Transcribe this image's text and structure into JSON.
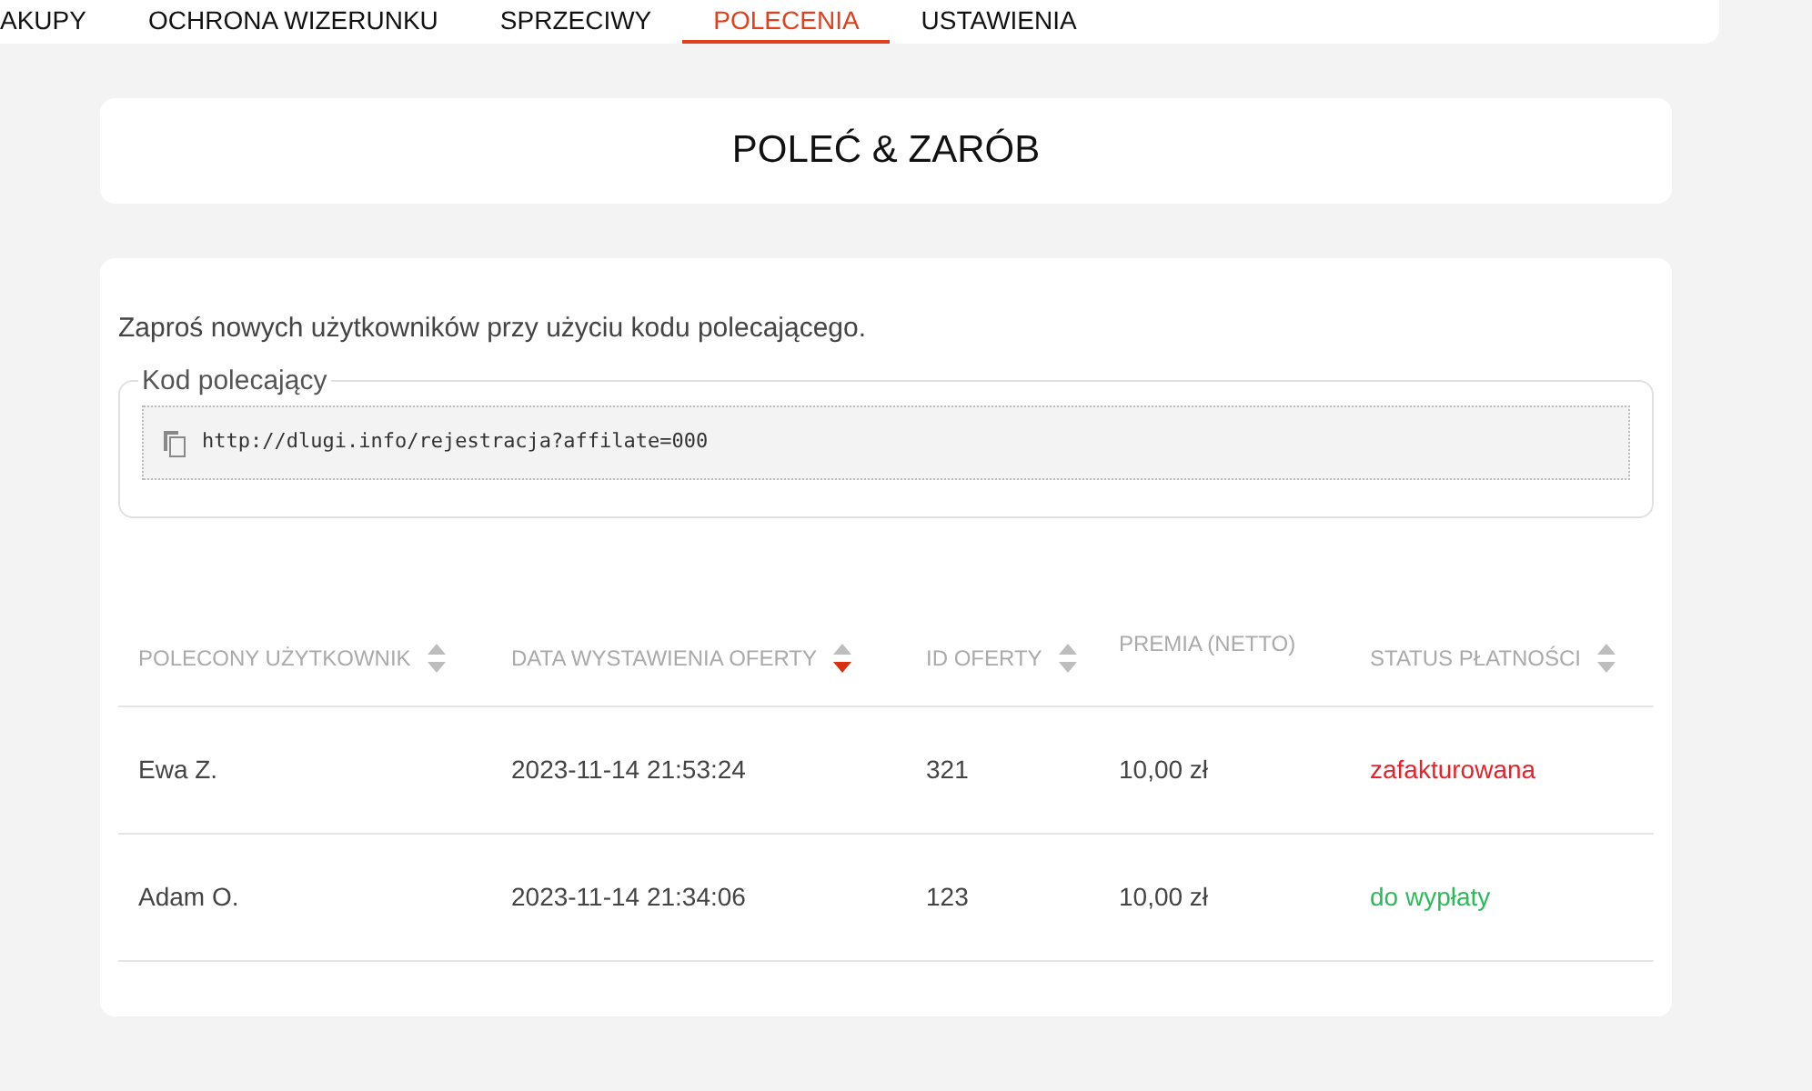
{
  "nav": {
    "tabs": [
      {
        "label": "AKUPY",
        "selected": false
      },
      {
        "label": "OCHRONA WIZERUNKU",
        "selected": false
      },
      {
        "label": "SPRZECIWY",
        "selected": false
      },
      {
        "label": "POLECENIA",
        "selected": true
      },
      {
        "label": "USTAWIENIA",
        "selected": false
      }
    ]
  },
  "header": {
    "title": "POLEĆ & ZARÓB"
  },
  "referral": {
    "intro": "Zaproś nowych użytkowników przy użyciu kodu polecającego.",
    "legend": "Kod polecający",
    "code": "http://dlugi.info/rejestracja?affilate=000"
  },
  "table": {
    "columns": [
      {
        "label": "POLECONY UŻYTKOWNIK",
        "kind": "sortable",
        "sorted": false
      },
      {
        "label": "DATA WYSTAWIENIA OFERTY",
        "kind": "sortable",
        "sorted": true
      },
      {
        "label": "ID OFERTY",
        "kind": "sortable",
        "sorted": false
      },
      {
        "label": "PREMIA (NETTO)",
        "kind": "plain"
      },
      {
        "label": "STATUS PŁATNOŚCI",
        "kind": "sortable",
        "sorted": false
      }
    ],
    "rows": [
      {
        "user": "Ewa Z.",
        "date": "2023-11-14 21:53:24",
        "id": "321",
        "bonus": "10,00 zł",
        "status": "zafakturowana",
        "color": "#e8222b"
      },
      {
        "user": "Adam O.",
        "date": "2023-11-14 21:34:06",
        "id": "123",
        "bonus": "10,00 zł",
        "status": "do wypłaty",
        "color": "#2dbb5a"
      }
    ]
  }
}
